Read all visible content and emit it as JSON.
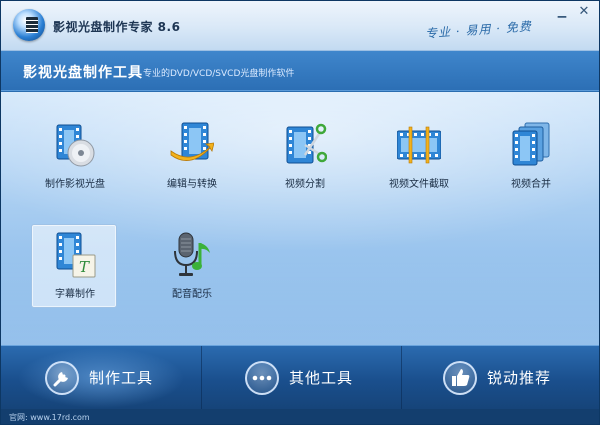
{
  "window": {
    "title": "影视光盘制作专家 8.6",
    "slogan": "专业 · 易用 · 免费",
    "minimize_glyph": "▁",
    "close_glyph": "✕"
  },
  "header": {
    "title": "影视光盘制作工具",
    "subtitle": "专业的DVD/VCD/SVCD光盘制作软件"
  },
  "tools": [
    {
      "label": "制作影视光盘",
      "icon": "film-disc-icon"
    },
    {
      "label": "编辑与转换",
      "icon": "film-arrow-icon"
    },
    {
      "label": "视频分割",
      "icon": "film-scissors-icon"
    },
    {
      "label": "视频文件截取",
      "icon": "film-strip-icon"
    },
    {
      "label": "视频合并",
      "icon": "film-stack-icon"
    },
    {
      "label": "字幕制作",
      "icon": "film-text-icon",
      "selected": true
    },
    {
      "label": "配音配乐",
      "icon": "microphone-music-icon"
    }
  ],
  "nav": [
    {
      "label": "制作工具",
      "icon": "wrench-icon",
      "active": true
    },
    {
      "label": "其他工具",
      "icon": "more-dots-icon"
    },
    {
      "label": "锐动推荐",
      "icon": "thumbs-up-icon"
    }
  ],
  "status": {
    "text": "官网: www.17rd.com"
  },
  "colors": {
    "title_bar": "#dbe9f8",
    "header_band": "#3679c0",
    "content_top": "#d4e8fb",
    "content_bottom": "#7eb3e7",
    "nav_bar": "#1a4f8d",
    "icon_blue": "#2f86d6"
  }
}
